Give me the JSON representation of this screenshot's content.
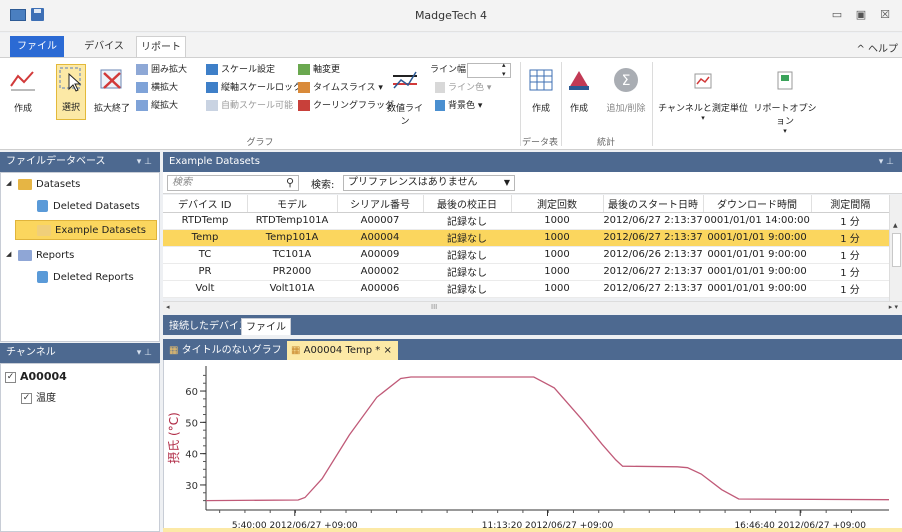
{
  "window": {
    "title": "MadgeTech 4",
    "minimize_glyph": "▭",
    "restore_glyph": "▣",
    "close_glyph": "☒"
  },
  "ribbon_tabs": {
    "file": "ファイル",
    "device": "デバイス",
    "report": "リポート",
    "help": "^  ヘルプ"
  },
  "ribbon": {
    "create": "作成",
    "select": "選択",
    "zoom_end": "拡大終了",
    "zoom_box": "囲み拡大",
    "zoom_h": "横拡大",
    "zoom_v": "縦拡大",
    "scale_setting": "スケール設定",
    "v_scale_lock": "縦軸スケールロック",
    "auto_scale": "自動スケール可能",
    "axis_change": "軸変更",
    "timeslice": "タイムスライス ▾",
    "cooling_flag": "クーリングフラッグ",
    "value_line": "数値ライン",
    "line_width": "ライン幅",
    "line_color": "ライン色 ▾",
    "bg_color": "背景色 ▾",
    "graph_group": "グラフ",
    "table_create": "作成",
    "table_group": "データ表",
    "stats_create": "作成",
    "stats_add": "追加/削除",
    "stats_group": "統計",
    "channel_units": "チャンネルと測定単位",
    "report_options": "リポートオプション"
  },
  "file_db": {
    "header": "ファイルデータベース",
    "pin": "▾ ⊥",
    "datasets": "Datasets",
    "deleted_datasets": "Deleted Datasets",
    "example_datasets": "Example Datasets",
    "reports": "Reports",
    "deleted_reports": "Deleted Reports"
  },
  "channel_pane": {
    "header": "チャンネル",
    "pin": "▾ ⊥",
    "device": "A00004",
    "channel": "温度",
    "check": "✓"
  },
  "datasets_panel": {
    "header": "Example Datasets",
    "pin": "▾ ⊥",
    "search_placeholder": "検索",
    "search_label": "検索:",
    "search_option": "プリファレンスはありません",
    "columns": [
      "デバイス ID",
      "モデル",
      "シリアル番号",
      "最後の校正日",
      "測定回数",
      "最後のスタート日時",
      "ダウンロード時間",
      "測定間隔"
    ],
    "rows": [
      [
        "RTDTemp",
        "RTDTemp101A",
        "A00007",
        "記録なし",
        "1000",
        "2012/06/27 2:13:37",
        "0001/01/01 14:00:00",
        "1 分"
      ],
      [
        "Temp",
        "Temp101A",
        "A00004",
        "記録なし",
        "1000",
        "2012/06/27 2:13:37",
        "0001/01/01 9:00:00",
        "1 分"
      ],
      [
        "TC",
        "TC101A",
        "A00009",
        "記録なし",
        "1000",
        "2012/06/26 2:13:37",
        "0001/01/01 9:00:00",
        "1 分"
      ],
      [
        "PR",
        "PR2000",
        "A00002",
        "記録なし",
        "1000",
        "2012/06/27 2:13:37",
        "0001/01/01 9:00:00",
        "1 分"
      ],
      [
        "Volt",
        "Volt101A",
        "A00006",
        "記録なし",
        "1000",
        "2012/06/27 2:13:37",
        "0001/01/01 9:00:00",
        "1 分"
      ]
    ],
    "hscroll_thumb": "III",
    "tab_connected": "接続したデバイス",
    "tab_file": "ファイル"
  },
  "doc_tabs": {
    "untitled": "タイトルのないグラフ",
    "active": "A00004 Temp *",
    "close": "×"
  },
  "chart_data": {
    "type": "line",
    "ylabel": "摂氏 (°C)",
    "yticks": [
      30,
      40,
      50,
      60
    ],
    "ylim": [
      22,
      68
    ],
    "xlim": [
      0,
      100
    ],
    "xticks": [
      {
        "x": 13,
        "label": "5:40:00 2012/06/27 +09:00"
      },
      {
        "x": 50,
        "label": "11:13:20 2012/06/27 +09:00"
      },
      {
        "x": 87,
        "label": "16:46:40 2012/06/27 +09:00"
      }
    ],
    "series": [
      {
        "color": "#c05a78",
        "x": [
          0,
          13.5,
          14.5,
          17,
          21,
          25,
          28.5,
          30,
          31,
          48,
          51,
          55,
          58,
          60,
          61,
          69,
          70.5,
          72.5,
          75.5,
          78,
          100
        ],
        "y": [
          25,
          25.2,
          26,
          32,
          46,
          58,
          64,
          64.5,
          64.5,
          64.5,
          61,
          51,
          43,
          38,
          36,
          35.8,
          35.5,
          33.5,
          28.5,
          25.5,
          25.3
        ]
      }
    ]
  }
}
